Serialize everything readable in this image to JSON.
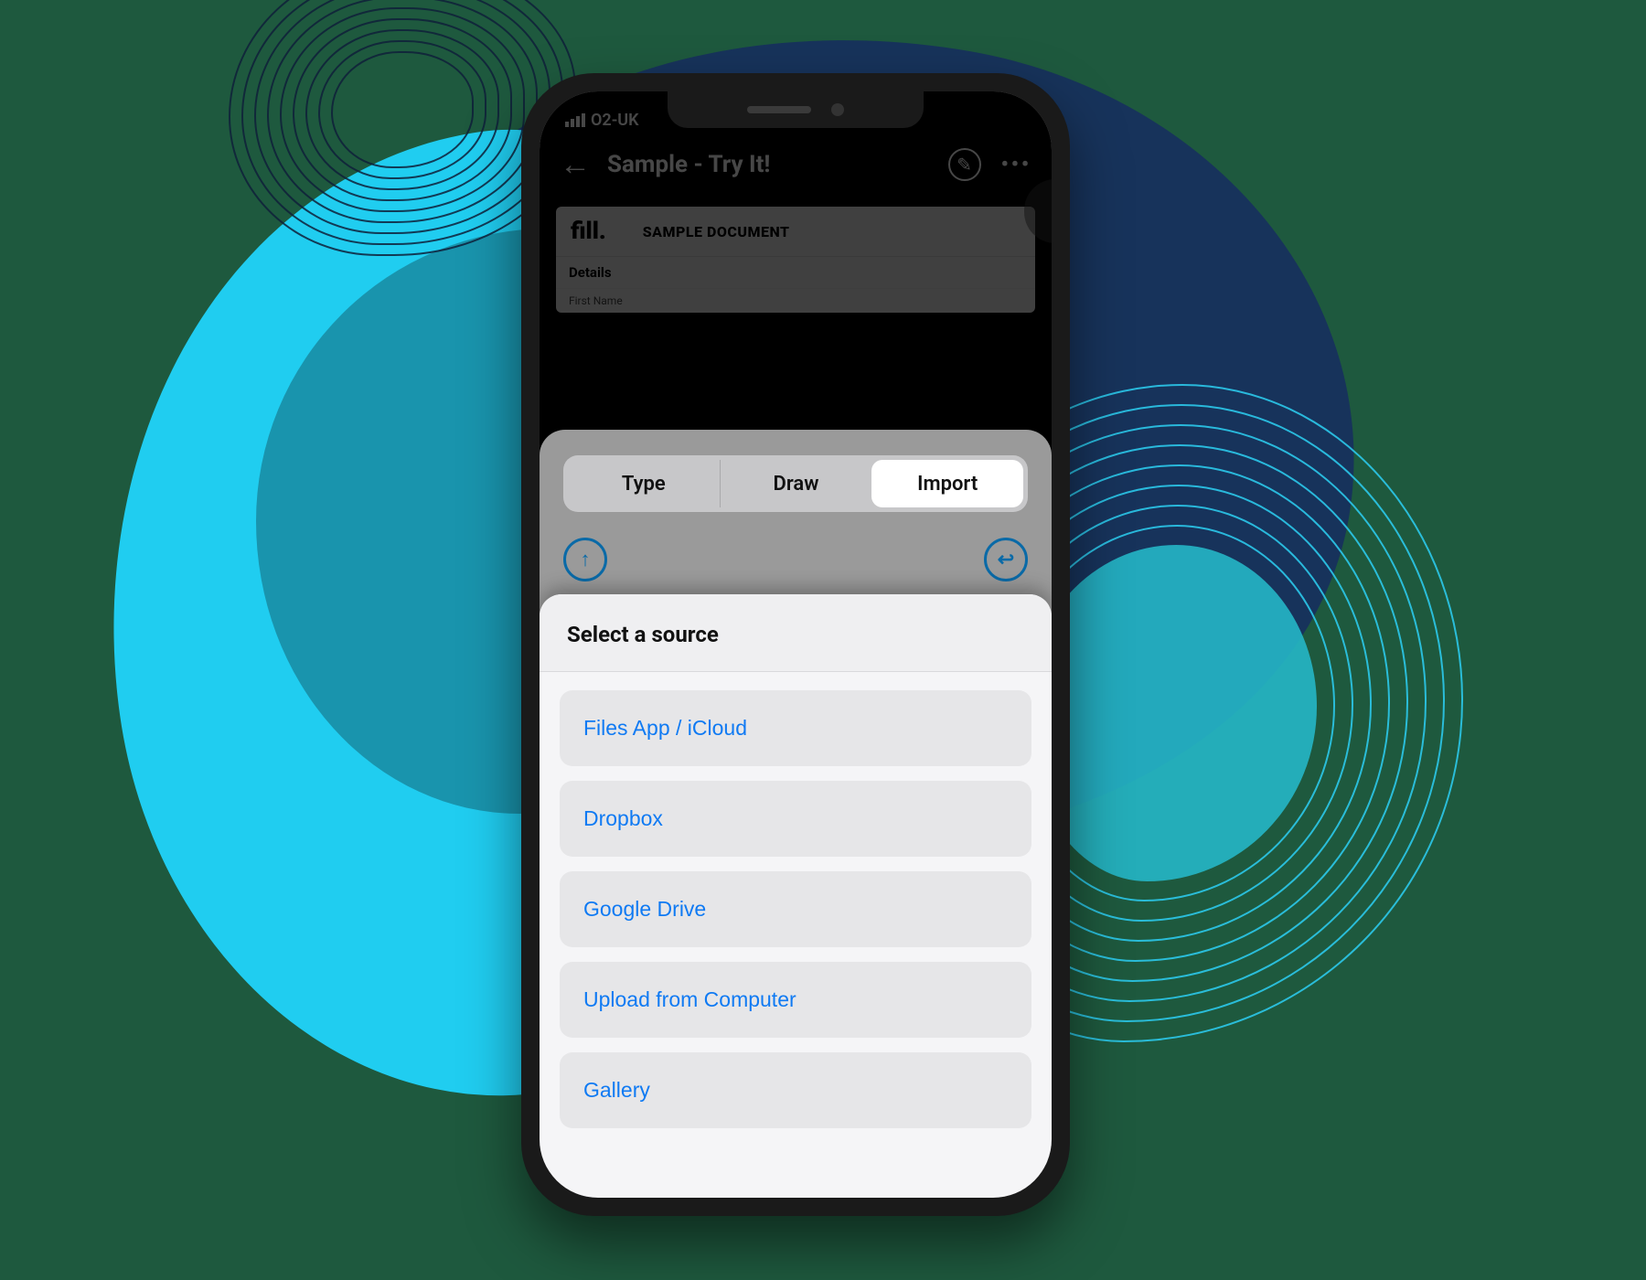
{
  "status": {
    "carrier": "O2-UK"
  },
  "nav": {
    "title": "Sample - Try It!"
  },
  "doc": {
    "brand": "fill.",
    "heading": "SAMPLE DOCUMENT",
    "section": "Details",
    "field1": "First Name"
  },
  "tabs": {
    "items": [
      "Type",
      "Draw",
      "Import"
    ]
  },
  "sheet": {
    "title": "Select a source",
    "sources": [
      "Files App / iCloud",
      "Dropbox",
      "Google Drive",
      "Upload from Computer",
      "Gallery"
    ]
  }
}
